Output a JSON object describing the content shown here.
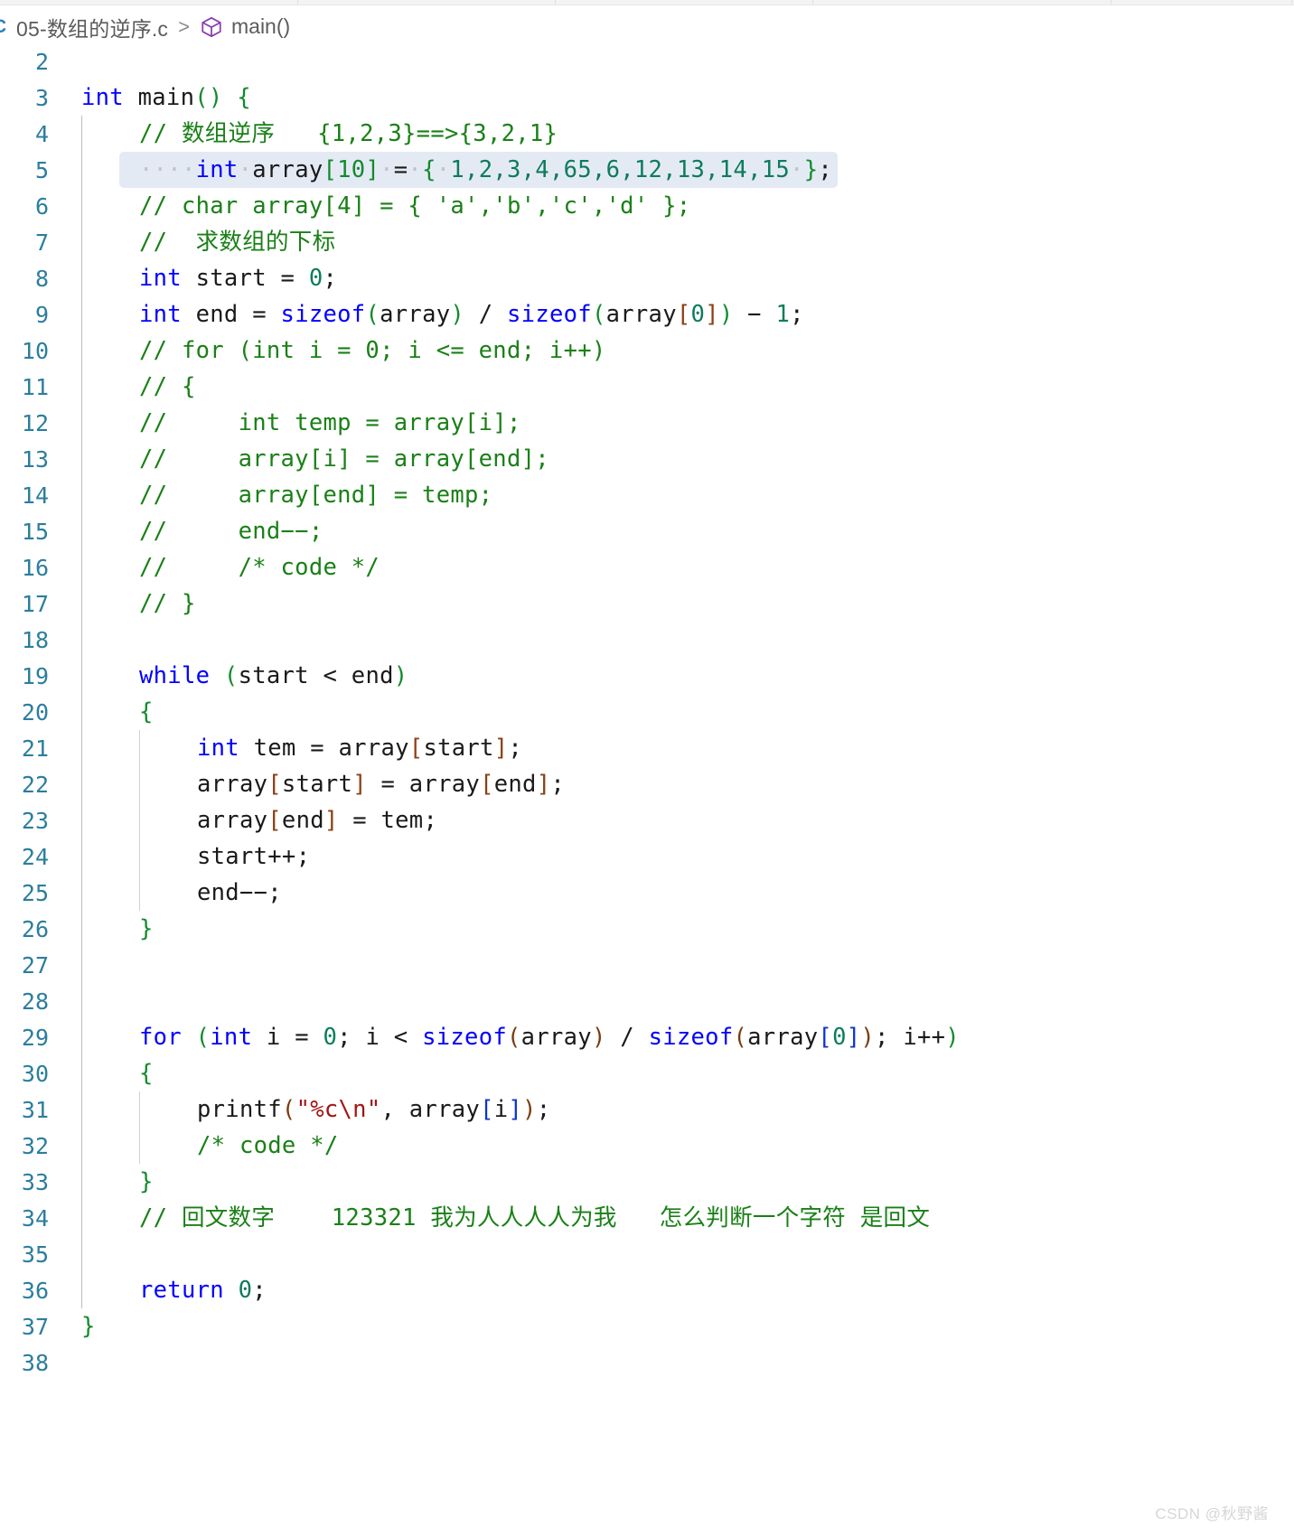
{
  "tabstrip": {
    "segment_widths": [
      330,
      285,
      285,
      330,
      200
    ]
  },
  "breadcrumb": {
    "c_icon_label": "C",
    "file_name": "05-数组的逆序.c",
    "separator": ">",
    "symbol_icon": "cube-icon",
    "symbol_name": "main()"
  },
  "editor": {
    "selected_line": 5,
    "first_visible_line": 2,
    "lines": [
      {
        "no": "2",
        "segments": []
      },
      {
        "no": "3",
        "segments": [
          {
            "t": "int",
            "c": "kw"
          },
          {
            "t": " main",
            "c": "plain"
          },
          {
            "t": "()",
            "c": "paren-g"
          },
          {
            "t": " ",
            "c": "plain"
          },
          {
            "t": "{",
            "c": "paren-g"
          }
        ]
      },
      {
        "no": "4",
        "indent": 1,
        "segments": [
          {
            "t": "// 数组逆序   {1,2,3}==>{3,2,1}",
            "c": "cmt"
          }
        ]
      },
      {
        "no": "5",
        "indent": 1,
        "selected": true,
        "segments": [
          {
            "t": "····",
            "c": "ws"
          },
          {
            "t": "int",
            "c": "kw"
          },
          {
            "t": "·",
            "c": "ws"
          },
          {
            "t": "array",
            "c": "plain"
          },
          {
            "t": "[10]",
            "c": "brk-gr"
          },
          {
            "t": "·",
            "c": "ws"
          },
          {
            "t": "=",
            "c": "plain"
          },
          {
            "t": "·",
            "c": "ws"
          },
          {
            "t": "{",
            "c": "brk-gr"
          },
          {
            "t": "·",
            "c": "ws"
          },
          {
            "t": "1,2,3,4,65,6,12,13,14,15",
            "c": "num"
          },
          {
            "t": "·",
            "c": "ws"
          },
          {
            "t": "}",
            "c": "brk-gr"
          },
          {
            "t": ";",
            "c": "plain"
          }
        ]
      },
      {
        "no": "6",
        "indent": 1,
        "segments": [
          {
            "t": "// char array[4] = { 'a','b','c','d' };",
            "c": "cmt"
          }
        ]
      },
      {
        "no": "7",
        "indent": 1,
        "segments": [
          {
            "t": "//  求数组的下标",
            "c": "cmt"
          }
        ]
      },
      {
        "no": "8",
        "indent": 1,
        "segments": [
          {
            "t": "int",
            "c": "kw"
          },
          {
            "t": " start = ",
            "c": "plain"
          },
          {
            "t": "0",
            "c": "num"
          },
          {
            "t": ";",
            "c": "plain"
          }
        ]
      },
      {
        "no": "9",
        "indent": 1,
        "segments": [
          {
            "t": "int",
            "c": "kw"
          },
          {
            "t": " end = ",
            "c": "plain"
          },
          {
            "t": "sizeof",
            "c": "fn"
          },
          {
            "t": "(",
            "c": "paren-g"
          },
          {
            "t": "array",
            "c": "plain"
          },
          {
            "t": ")",
            "c": "paren-g"
          },
          {
            "t": " / ",
            "c": "plain"
          },
          {
            "t": "sizeof",
            "c": "fn"
          },
          {
            "t": "(",
            "c": "paren-g"
          },
          {
            "t": "array",
            "c": "plain"
          },
          {
            "t": "[",
            "c": "brk-br"
          },
          {
            "t": "0",
            "c": "num"
          },
          {
            "t": "]",
            "c": "brk-br"
          },
          {
            "t": ")",
            "c": "paren-g"
          },
          {
            "t": " − ",
            "c": "plain"
          },
          {
            "t": "1",
            "c": "num"
          },
          {
            "t": ";",
            "c": "plain"
          }
        ]
      },
      {
        "no": "10",
        "indent": 1,
        "segments": [
          {
            "t": "// for (int i = 0; i <= end; i++)",
            "c": "cmt"
          }
        ]
      },
      {
        "no": "11",
        "indent": 1,
        "segments": [
          {
            "t": "// {",
            "c": "cmt"
          }
        ]
      },
      {
        "no": "12",
        "indent": 1,
        "segments": [
          {
            "t": "//     int temp = array[i];",
            "c": "cmt"
          }
        ]
      },
      {
        "no": "13",
        "indent": 1,
        "segments": [
          {
            "t": "//     array[i] = array[end];",
            "c": "cmt"
          }
        ]
      },
      {
        "no": "14",
        "indent": 1,
        "segments": [
          {
            "t": "//     array[end] = temp;",
            "c": "cmt"
          }
        ]
      },
      {
        "no": "15",
        "indent": 1,
        "segments": [
          {
            "t": "//     end−−;",
            "c": "cmt"
          }
        ]
      },
      {
        "no": "16",
        "indent": 1,
        "segments": [
          {
            "t": "//     /* code */",
            "c": "cmt"
          }
        ]
      },
      {
        "no": "17",
        "indent": 1,
        "segments": [
          {
            "t": "// }",
            "c": "cmt"
          }
        ]
      },
      {
        "no": "18",
        "indent": 1,
        "segments": []
      },
      {
        "no": "19",
        "indent": 1,
        "segments": [
          {
            "t": "while",
            "c": "kw"
          },
          {
            "t": " ",
            "c": "plain"
          },
          {
            "t": "(",
            "c": "paren-g"
          },
          {
            "t": "start < end",
            "c": "plain"
          },
          {
            "t": ")",
            "c": "paren-g"
          }
        ]
      },
      {
        "no": "20",
        "indent": 1,
        "segments": [
          {
            "t": "{",
            "c": "paren-g"
          }
        ]
      },
      {
        "no": "21",
        "indent": 2,
        "segments": [
          {
            "t": "int",
            "c": "kw"
          },
          {
            "t": " tem = array",
            "c": "plain"
          },
          {
            "t": "[",
            "c": "brk-br"
          },
          {
            "t": "start",
            "c": "plain"
          },
          {
            "t": "]",
            "c": "brk-br"
          },
          {
            "t": ";",
            "c": "plain"
          }
        ]
      },
      {
        "no": "22",
        "indent": 2,
        "segments": [
          {
            "t": "array",
            "c": "plain"
          },
          {
            "t": "[",
            "c": "brk-br"
          },
          {
            "t": "start",
            "c": "plain"
          },
          {
            "t": "]",
            "c": "brk-br"
          },
          {
            "t": " = array",
            "c": "plain"
          },
          {
            "t": "[",
            "c": "brk-br"
          },
          {
            "t": "end",
            "c": "plain"
          },
          {
            "t": "]",
            "c": "brk-br"
          },
          {
            "t": ";",
            "c": "plain"
          }
        ]
      },
      {
        "no": "23",
        "indent": 2,
        "segments": [
          {
            "t": "array",
            "c": "plain"
          },
          {
            "t": "[",
            "c": "brk-br"
          },
          {
            "t": "end",
            "c": "plain"
          },
          {
            "t": "]",
            "c": "brk-br"
          },
          {
            "t": " = tem;",
            "c": "plain"
          }
        ]
      },
      {
        "no": "24",
        "indent": 2,
        "segments": [
          {
            "t": "start++;",
            "c": "plain"
          }
        ]
      },
      {
        "no": "25",
        "indent": 2,
        "segments": [
          {
            "t": "end−−;",
            "c": "plain"
          }
        ]
      },
      {
        "no": "26",
        "indent": 1,
        "segments": [
          {
            "t": "}",
            "c": "paren-g"
          }
        ]
      },
      {
        "no": "27",
        "indent": 1,
        "segments": []
      },
      {
        "no": "28",
        "indent": 1,
        "segments": []
      },
      {
        "no": "29",
        "indent": 1,
        "segments": [
          {
            "t": "for",
            "c": "kw"
          },
          {
            "t": " ",
            "c": "plain"
          },
          {
            "t": "(",
            "c": "paren-g"
          },
          {
            "t": "int",
            "c": "kw"
          },
          {
            "t": " i = ",
            "c": "plain"
          },
          {
            "t": "0",
            "c": "num"
          },
          {
            "t": "; i < ",
            "c": "plain"
          },
          {
            "t": "sizeof",
            "c": "fn"
          },
          {
            "t": "(",
            "c": "paren-br"
          },
          {
            "t": "array",
            "c": "plain"
          },
          {
            "t": ")",
            "c": "paren-br"
          },
          {
            "t": " / ",
            "c": "plain"
          },
          {
            "t": "sizeof",
            "c": "fn"
          },
          {
            "t": "(",
            "c": "paren-br"
          },
          {
            "t": "array",
            "c": "plain"
          },
          {
            "t": "[",
            "c": "brk-bl"
          },
          {
            "t": "0",
            "c": "num"
          },
          {
            "t": "]",
            "c": "brk-bl"
          },
          {
            "t": ")",
            "c": "paren-br"
          },
          {
            "t": "; i++",
            "c": "plain"
          },
          {
            "t": ")",
            "c": "paren-g"
          }
        ]
      },
      {
        "no": "30",
        "indent": 1,
        "segments": [
          {
            "t": "{",
            "c": "paren-g"
          }
        ]
      },
      {
        "no": "31",
        "indent": 2,
        "segments": [
          {
            "t": "printf",
            "c": "plain"
          },
          {
            "t": "(",
            "c": "paren-br"
          },
          {
            "t": "\"%c\\n\"",
            "c": "str"
          },
          {
            "t": ", array",
            "c": "plain"
          },
          {
            "t": "[",
            "c": "brk-bl"
          },
          {
            "t": "i",
            "c": "plain"
          },
          {
            "t": "]",
            "c": "brk-bl"
          },
          {
            "t": ")",
            "c": "paren-br"
          },
          {
            "t": ";",
            "c": "plain"
          }
        ]
      },
      {
        "no": "32",
        "indent": 2,
        "segments": [
          {
            "t": "/* code */",
            "c": "cmt"
          }
        ]
      },
      {
        "no": "33",
        "indent": 1,
        "segments": [
          {
            "t": "}",
            "c": "paren-g"
          }
        ]
      },
      {
        "no": "34",
        "indent": 1,
        "segments": [
          {
            "t": "// 回文数字    123321 我为人人人人为我   怎么判断一个字符 是回文",
            "c": "cmt"
          }
        ]
      },
      {
        "no": "35",
        "indent": 1,
        "segments": []
      },
      {
        "no": "36",
        "indent": 1,
        "segments": [
          {
            "t": "return",
            "c": "kw"
          },
          {
            "t": " ",
            "c": "plain"
          },
          {
            "t": "0",
            "c": "num"
          },
          {
            "t": ";",
            "c": "plain"
          }
        ]
      },
      {
        "no": "37",
        "segments": [
          {
            "t": "}",
            "c": "paren-g"
          }
        ]
      },
      {
        "no": "38",
        "segments": []
      }
    ]
  },
  "watermark": {
    "text": "CSDN @秋野酱"
  }
}
